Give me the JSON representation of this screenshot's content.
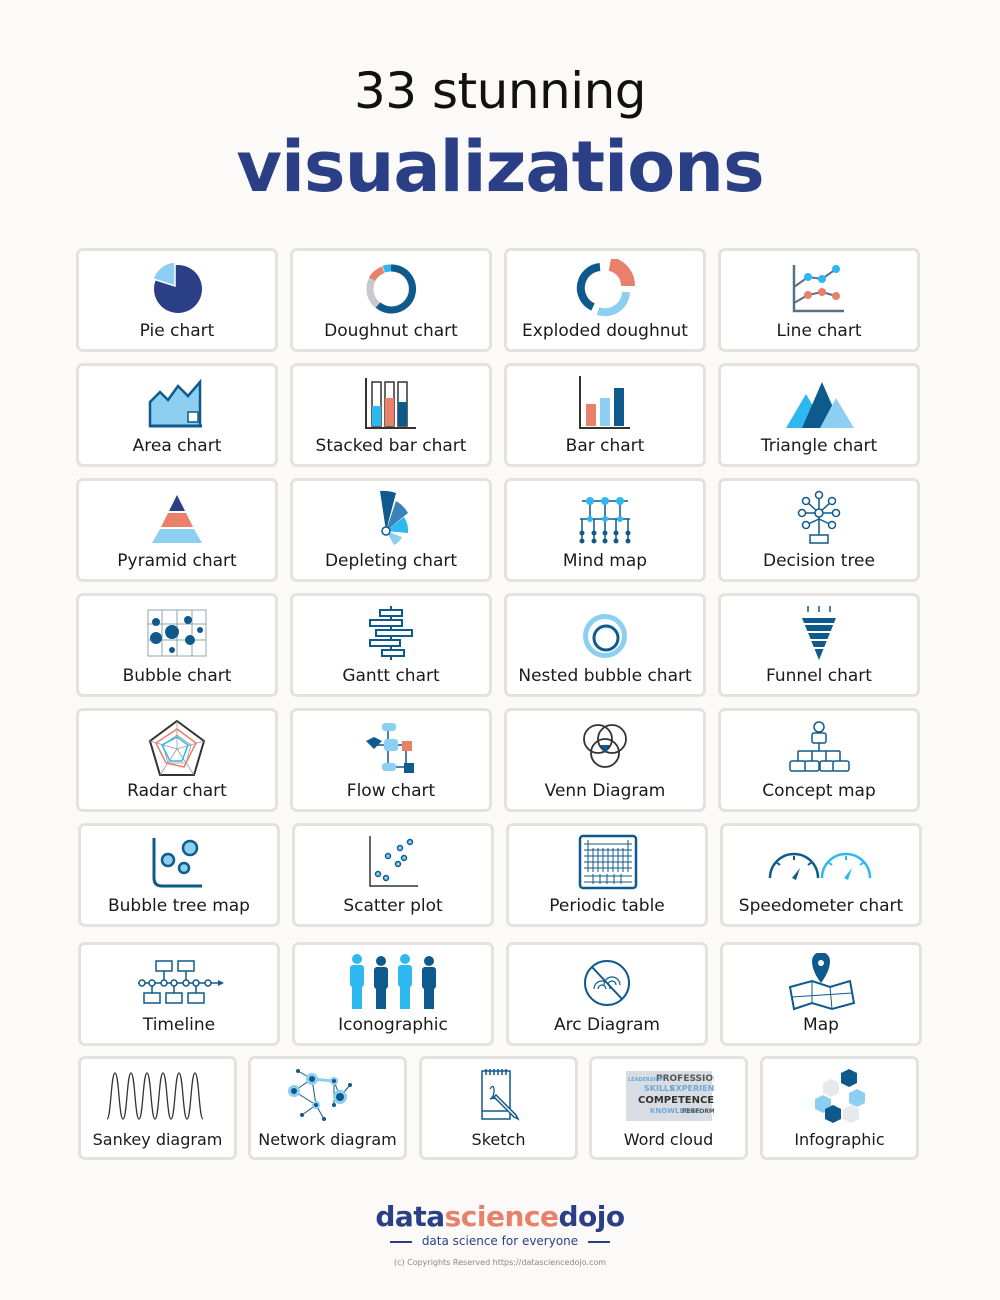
{
  "header": {
    "line1": "33 stunning",
    "line2": "visualizations"
  },
  "colors": {
    "navy": "#2b3f86",
    "blue": "#0f5a8c",
    "light_blue": "#8ccff0",
    "sky": "#2db8f0",
    "coral": "#e8806a",
    "gray": "#c8c9cc"
  },
  "cards": [
    {
      "label": "Pie chart",
      "icon": "pie-chart-icon"
    },
    {
      "label": "Doughnut chart",
      "icon": "doughnut-chart-icon"
    },
    {
      "label": "Exploded doughnut",
      "icon": "exploded-doughnut-icon"
    },
    {
      "label": "Line chart",
      "icon": "line-chart-icon"
    },
    {
      "label": "Area chart",
      "icon": "area-chart-icon"
    },
    {
      "label": "Stacked bar chart",
      "icon": "stacked-bar-chart-icon"
    },
    {
      "label": "Bar chart",
      "icon": "bar-chart-icon"
    },
    {
      "label": "Triangle chart",
      "icon": "triangle-chart-icon"
    },
    {
      "label": "Pyramid chart",
      "icon": "pyramid-chart-icon"
    },
    {
      "label": "Depleting chart",
      "icon": "depleting-chart-icon"
    },
    {
      "label": "Mind map",
      "icon": "mind-map-icon"
    },
    {
      "label": "Decision tree",
      "icon": "decision-tree-icon"
    },
    {
      "label": "Bubble chart",
      "icon": "bubble-chart-icon"
    },
    {
      "label": "Gantt chart",
      "icon": "gantt-chart-icon"
    },
    {
      "label": "Nested bubble chart",
      "icon": "nested-bubble-chart-icon"
    },
    {
      "label": "Funnel chart",
      "icon": "funnel-chart-icon"
    },
    {
      "label": "Radar chart",
      "icon": "radar-chart-icon"
    },
    {
      "label": "Flow chart",
      "icon": "flow-chart-icon"
    },
    {
      "label": "Venn Diagram",
      "icon": "venn-diagram-icon"
    },
    {
      "label": "Concept map",
      "icon": "concept-map-icon"
    },
    {
      "label": "Bubble tree map",
      "icon": "bubble-tree-map-icon"
    },
    {
      "label": "Scatter plot",
      "icon": "scatter-plot-icon"
    },
    {
      "label": "Periodic table",
      "icon": "periodic-table-icon"
    },
    {
      "label": "Speedometer chart",
      "icon": "speedometer-chart-icon"
    },
    {
      "label": "Timeline",
      "icon": "timeline-icon"
    },
    {
      "label": "Iconographic",
      "icon": "iconographic-icon"
    },
    {
      "label": "Arc Diagram",
      "icon": "arc-diagram-icon"
    },
    {
      "label": "Map",
      "icon": "map-icon"
    },
    {
      "label": "Sankey diagram",
      "icon": "sankey-diagram-icon"
    },
    {
      "label": "Network diagram",
      "icon": "network-diagram-icon"
    },
    {
      "label": "Sketch",
      "icon": "sketch-icon"
    },
    {
      "label": "Word cloud",
      "icon": "word-cloud-icon"
    },
    {
      "label": "Infographic",
      "icon": "infographic-icon"
    }
  ],
  "footer": {
    "logo_part1": "data",
    "logo_part2": "science",
    "logo_part3": "dojo",
    "tagline": "data science for everyone",
    "copyright": "(c) Copyrights Reserved  https://datasciencedojo.com"
  }
}
